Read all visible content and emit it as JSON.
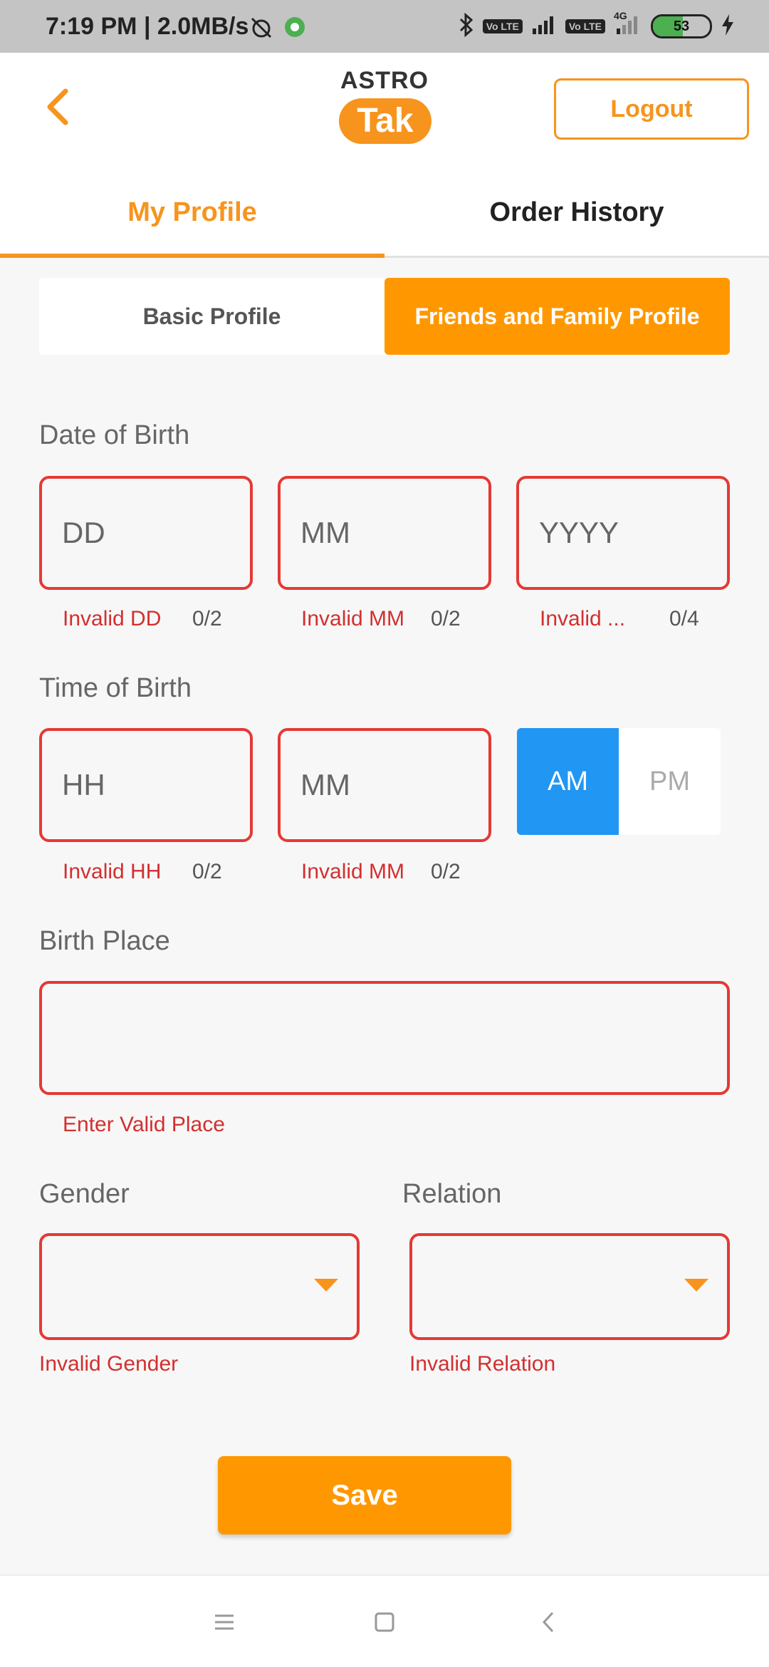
{
  "status_bar": {
    "time_speed": "7:19 PM | 2.0MB/s",
    "battery": "53",
    "battery_level": 0.53,
    "volte1": "Vo LTE",
    "volte2": "Vo LTE",
    "network": "4G"
  },
  "header": {
    "logo_top": "ASTRO",
    "logo_bottom": "Tak",
    "logout_label": "Logout"
  },
  "tabs": [
    {
      "label": "My Profile",
      "active": true
    },
    {
      "label": "Order History",
      "active": false
    }
  ],
  "subtabs": {
    "basic": "Basic Profile",
    "friends_family": "Friends and Family Profile"
  },
  "date_of_birth": {
    "label": "Date of Birth",
    "dd": {
      "placeholder": "DD",
      "error": "Invalid DD",
      "counter": "0/2"
    },
    "mm": {
      "placeholder": "MM",
      "error": "Invalid MM",
      "counter": "0/2"
    },
    "yyyy": {
      "placeholder": "YYYY",
      "error": "Invalid ...",
      "counter": "0/4"
    }
  },
  "time_of_birth": {
    "label": "Time of Birth",
    "hh": {
      "placeholder": "HH",
      "error": "Invalid HH",
      "counter": "0/2"
    },
    "mm": {
      "placeholder": "MM",
      "error": "Invalid MM",
      "counter": "0/2"
    },
    "am": "AM",
    "pm": "PM",
    "selected": "AM"
  },
  "birth_place": {
    "label": "Birth Place",
    "value": "",
    "error": "Enter Valid Place"
  },
  "gender": {
    "label": "Gender",
    "value": "",
    "error": "Invalid Gender"
  },
  "relation": {
    "label": "Relation",
    "value": "",
    "error": "Invalid Relation"
  },
  "save_label": "Save",
  "colors": {
    "accent": "#f7941d",
    "error": "#e53935",
    "am_selected": "#2196f3"
  }
}
